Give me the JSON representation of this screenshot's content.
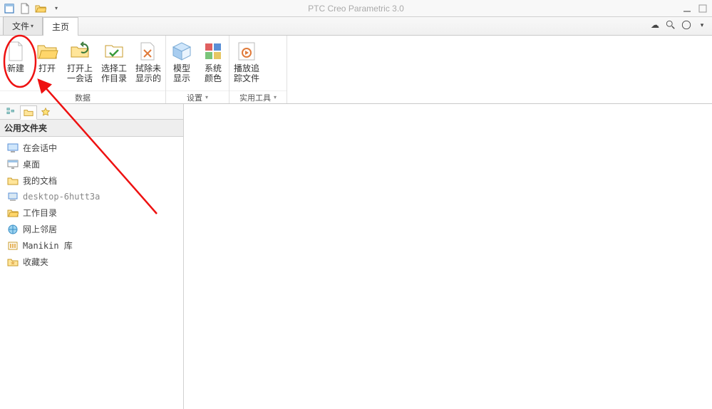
{
  "app_title": "PTC Creo Parametric 3.0",
  "tabs": {
    "file_label": "文件",
    "home_label": "主页"
  },
  "ribbon": {
    "group_data": {
      "label": "数据",
      "new": "新建",
      "open": "打开",
      "open_last": "打开上\n一会话",
      "select_wd": "选择工\n作目录",
      "erase_nd": "拭除未\n显示的"
    },
    "group_settings": {
      "label": "设置",
      "model_disp": "模型\n显示",
      "sys_colors": "系统\n颜色"
    },
    "group_util": {
      "label": "实用工具",
      "play_trail": "播放追\n踪文件"
    }
  },
  "sidebar": {
    "header": "公用文件夹",
    "items": [
      {
        "label": "在会话中",
        "icon": "monitor"
      },
      {
        "label": "桌面",
        "icon": "desktop"
      },
      {
        "label": "我的文档",
        "icon": "folder"
      },
      {
        "label": "desktop-6hutt3a",
        "icon": "computer"
      },
      {
        "label": "工作目录",
        "icon": "folder-open"
      },
      {
        "label": "网上邻居",
        "icon": "network"
      },
      {
        "label": "Manikin 库",
        "icon": "library"
      },
      {
        "label": "收藏夹",
        "icon": "favorites"
      }
    ]
  }
}
